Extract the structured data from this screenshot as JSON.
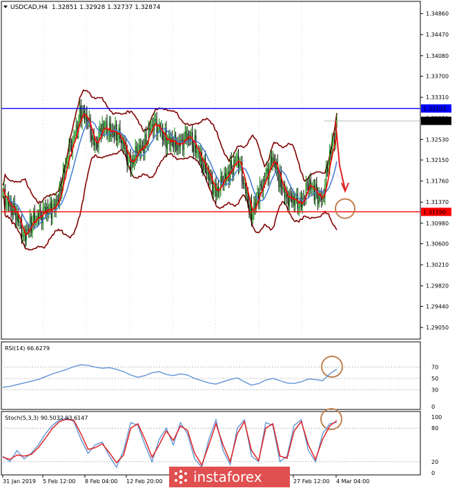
{
  "header": {
    "symbol": "USDCAD,H4",
    "ohlc": "1.32851 1.32928 1.32737 1.32874"
  },
  "colors": {
    "background": "#ffffff",
    "bull": "#008000",
    "bear": "#000000",
    "resistance": "#0000ff",
    "support": "#ff0000",
    "bollinger": "#800000",
    "ma_fast": "#ff0000",
    "ma_slow": "#4a7fd4",
    "rsi": "#6a9ad8",
    "stoch_main": "#6a9ad8",
    "stoch_signal": "#e02020",
    "annotation": "#c08050",
    "arrow": "#e02020",
    "watermark_bg": "#e05050"
  },
  "chart_data": [
    {
      "type": "candlestick",
      "panel": "main",
      "ylim": [
        1.2886,
        1.3506
      ],
      "price_ticks": [
        "1.34860",
        "1.34470",
        "1.34080",
        "1.33700",
        "1.33310",
        "1.32920",
        "1.32530",
        "1.32150",
        "1.31760",
        "1.31370",
        "1.30980",
        "1.30600",
        "1.30210",
        "1.29820",
        "1.29440",
        "1.29050"
      ],
      "levels": {
        "resistance": "1.33103",
        "current": "1.32874",
        "support": "1.31190"
      },
      "close_path": [
        1.315,
        1.3135,
        1.3105,
        1.308,
        1.3095,
        1.311,
        1.3125,
        1.3115,
        1.316,
        1.321,
        1.326,
        1.3305,
        1.328,
        1.3245,
        1.327,
        1.3275,
        1.3265,
        1.324,
        1.321,
        1.3225,
        1.325,
        1.328,
        1.3275,
        1.3255,
        1.324,
        1.325,
        1.3255,
        1.3245,
        1.3215,
        1.318,
        1.316,
        1.317,
        1.32,
        1.322,
        1.3165,
        1.312,
        1.3145,
        1.319,
        1.3215,
        1.3175,
        1.315,
        1.3135,
        1.314,
        1.3165,
        1.3155,
        1.3145,
        1.322,
        1.3287
      ],
      "projection": [
        1.3287,
        1.3205,
        1.316
      ]
    },
    {
      "type": "line",
      "panel": "rsi",
      "title": "RSI(14) 66.6279",
      "ylim": [
        0,
        100
      ],
      "ticks": [
        "70",
        "50",
        "30",
        "0"
      ],
      "values": [
        34,
        36,
        39,
        42,
        45,
        48,
        53,
        58,
        62,
        66,
        71,
        74,
        73,
        70,
        68,
        69,
        66,
        62,
        56,
        52,
        55,
        60,
        62,
        57,
        55,
        58,
        56,
        50,
        46,
        42,
        40,
        44,
        48,
        51,
        44,
        38,
        41,
        47,
        50,
        46,
        42,
        41,
        44,
        49,
        48,
        46,
        58,
        66.6
      ]
    },
    {
      "type": "line",
      "panel": "stoch",
      "title": "Stoch(5,3,3) 90.5032 93.6147",
      "ylim": [
        0,
        100
      ],
      "ticks": [
        "100",
        "80",
        "20",
        "0"
      ],
      "main": [
        30,
        20,
        40,
        25,
        35,
        50,
        70,
        85,
        95,
        98,
        92,
        60,
        35,
        50,
        55,
        30,
        10,
        40,
        90,
        85,
        50,
        20,
        60,
        80,
        50,
        90,
        70,
        25,
        10,
        60,
        95,
        40,
        15,
        80,
        95,
        30,
        20,
        90,
        85,
        20,
        30,
        85,
        95,
        40,
        20,
        70,
        88,
        90.5
      ],
      "signal": [
        28,
        24,
        32,
        30,
        33,
        45,
        62,
        80,
        92,
        96,
        94,
        70,
        42,
        45,
        52,
        36,
        18,
        32,
        80,
        88,
        60,
        28,
        50,
        75,
        58,
        84,
        76,
        35,
        14,
        50,
        88,
        50,
        20,
        70,
        92,
        40,
        22,
        80,
        88,
        30,
        26,
        75,
        92,
        50,
        24,
        60,
        84,
        93.6
      ]
    }
  ],
  "time_axis": [
    "31 Jan 2019",
    "5 Feb 12:00",
    "8 Feb 04:00",
    "12 Feb 20:00",
    "27 Feb 12:00",
    "4 Mar 04:00"
  ],
  "watermark": "instaforex"
}
